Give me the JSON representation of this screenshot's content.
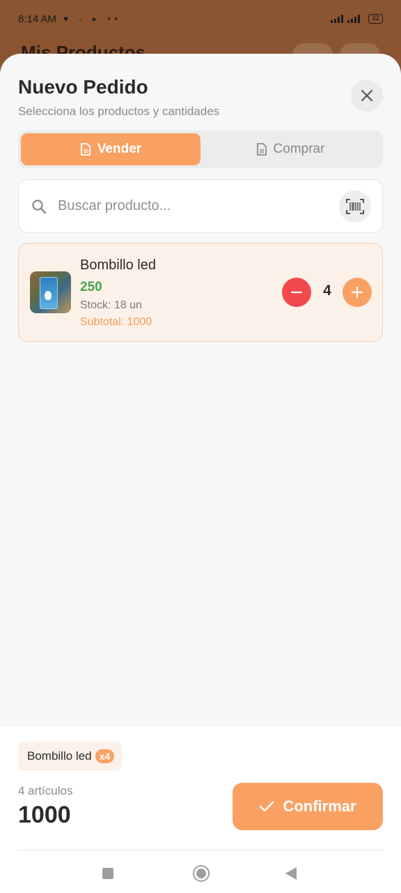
{
  "status_bar": {
    "time": "8:14 AM",
    "left_icons": "♥ ˗ ▸ ••",
    "battery": "32"
  },
  "background_page": {
    "title": "Mis Productos"
  },
  "header": {
    "title": "Nuevo Pedido",
    "subtitle": "Selecciona los productos y cantidades",
    "close_icon": "close-icon"
  },
  "tabs": [
    {
      "label": "Vender",
      "icon": "file-icon",
      "active": true
    },
    {
      "label": "Comprar",
      "icon": "file-icon",
      "active": false
    }
  ],
  "search": {
    "placeholder": "Buscar producto...",
    "value": "",
    "icon": "search-icon",
    "scan_icon": "barcode-scan-icon"
  },
  "products": [
    {
      "name": "Bombillo led",
      "price": "250",
      "stock": "Stock: 18 un",
      "subtotal": "Subtotal: 1000",
      "quantity": "4"
    }
  ],
  "footer": {
    "chip_label": "Bombillo led",
    "chip_badge": "x4",
    "items_count": "4 artículos",
    "total": "1000",
    "confirm_label": "Confirmar"
  },
  "colors": {
    "accent": "#f9a163",
    "price_green": "#47a34f",
    "minus_red": "#f2494c",
    "backdrop": "#8a5530"
  }
}
